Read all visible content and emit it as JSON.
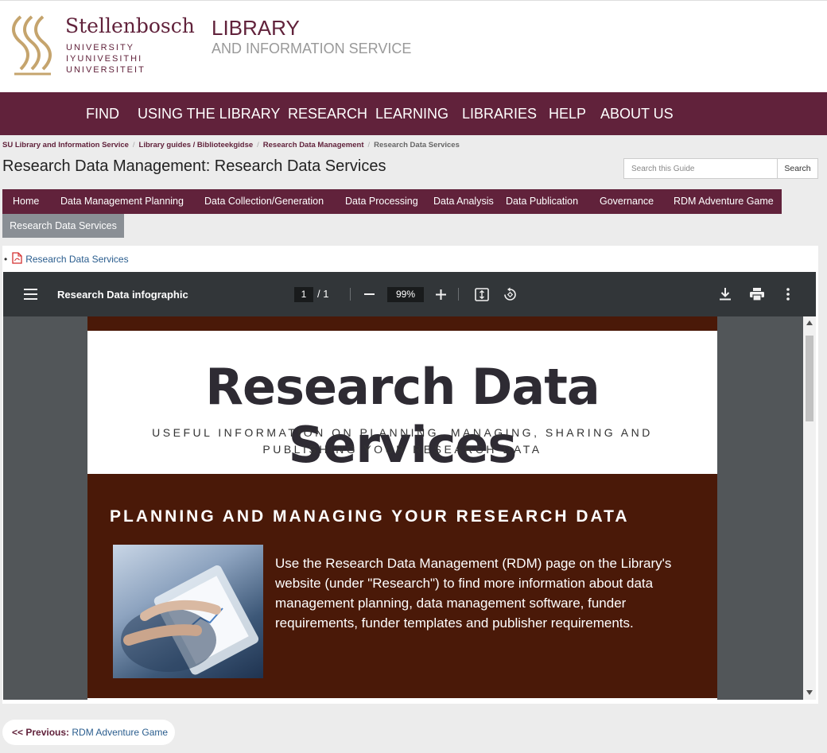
{
  "header": {
    "university_name": "Stellenbosch",
    "university_lines": [
      "UNIVERSITY",
      "IYUNIVESITHI",
      "UNIVERSITEIT"
    ],
    "library_title": "LIBRARY",
    "library_subtitle": "AND INFORMATION SERVICE",
    "brand_color": "#61223b",
    "logo_color": "#c5a46d"
  },
  "mainnav": [
    "FIND",
    "USING THE LIBRARY",
    "RESEARCH",
    "LEARNING",
    "LIBRARIES",
    "HELP",
    "ABOUT US"
  ],
  "breadcrumb": {
    "items": [
      "SU Library and Information Service",
      "Library guides / Biblioteekgidse",
      "Research Data Management"
    ],
    "current": "Research Data Services"
  },
  "page_title": "Research Data Management: Research Data Services",
  "search": {
    "placeholder": "Search this Guide",
    "button": "Search"
  },
  "tabs": [
    "Home",
    "Data Management Planning",
    "Data Collection/Generation",
    "Data Processing",
    "Data Analysis",
    "Data Publication",
    "Governance",
    "RDM Adventure Game"
  ],
  "active_tab": "Research Data Services",
  "file_link": "Research Data Services",
  "viewer": {
    "title": "Research Data infographic",
    "page_current": "1",
    "page_total": "/ 1",
    "zoom": "99%",
    "icons": [
      "menu-icon",
      "minus-icon",
      "plus-icon",
      "fit-page-icon",
      "rotate-icon",
      "download-icon",
      "print-icon",
      "more-vert-icon"
    ]
  },
  "pdf": {
    "title": "Research Data Services",
    "subtitle_line1": "USEFUL INFORMATION ON PLANNING, MANAGING, SHARING AND",
    "subtitle_line2": "PUBLISHING YOUR RESEARCH DATA",
    "section_heading": "PLANNING AND MANAGING YOUR RESEARCH DATA",
    "section_text": "Use the Research Data Management (RDM) page on the Library's website (under \"Research\") to find more information about data management planning, data management software, funder requirements, funder templates and publisher requirements.",
    "dark_color": "#4a1908"
  },
  "prev": {
    "label": "<< Previous:",
    "target": "RDM Adventure Game"
  }
}
